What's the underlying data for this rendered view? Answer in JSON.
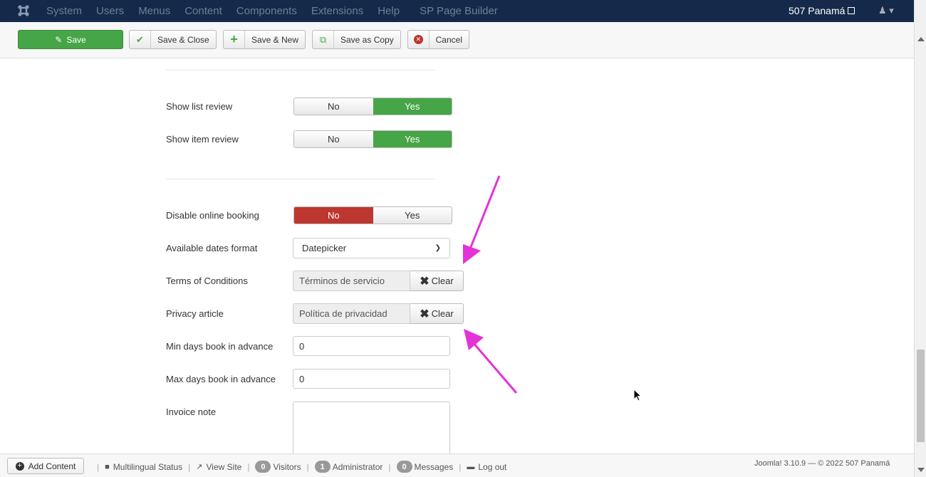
{
  "topnav": {
    "menu": [
      "System",
      "Users",
      "Menus",
      "Content",
      "Components",
      "Extensions",
      "Help",
      "SP Page Builder"
    ],
    "site_name": "507 Panamá",
    "user_icon": "user-icon",
    "logo_icon": "joomla-logo-icon"
  },
  "toolbar": {
    "save": "Save",
    "save_close": "Save & Close",
    "save_new": "Save & New",
    "save_copy": "Save as Copy",
    "cancel": "Cancel"
  },
  "form": {
    "show_list_review": {
      "label": "Show list review",
      "no": "No",
      "yes": "Yes",
      "value": "Yes"
    },
    "show_item_review": {
      "label": "Show item review",
      "no": "No",
      "yes": "Yes",
      "value": "Yes"
    },
    "disable_online_booking": {
      "label": "Disable online booking",
      "no": "No",
      "yes": "Yes",
      "value": "No"
    },
    "available_dates_format": {
      "label": "Available dates format",
      "value": "Datepicker"
    },
    "terms_of_conditions": {
      "label": "Terms of Conditions",
      "value": "Términos de servicio",
      "clear": "Clear"
    },
    "privacy_article": {
      "label": "Privacy article",
      "value": "Política de privacidad",
      "clear": "Clear"
    },
    "min_days": {
      "label": "Min days book in advance",
      "value": "0"
    },
    "max_days": {
      "label": "Max days book in advance",
      "value": "0"
    },
    "invoice_note": {
      "label": "Invoice note",
      "value": ""
    }
  },
  "status": {
    "add_content": "Add Content",
    "multilingual": "Multilingual Status",
    "view_site": "View Site",
    "visitors_count": "0",
    "visitors": "Visitors",
    "admin_count": "1",
    "administrator": "Administrator",
    "messages_count": "0",
    "messages": "Messages",
    "logout": "Log out",
    "version": "Joomla! 3.10.9 — © 2022 507 Panamá"
  },
  "colors": {
    "navbar": "#152a4a",
    "green": "#46a546",
    "red": "#bd362f",
    "annotation_arrow": "#e432d6"
  }
}
